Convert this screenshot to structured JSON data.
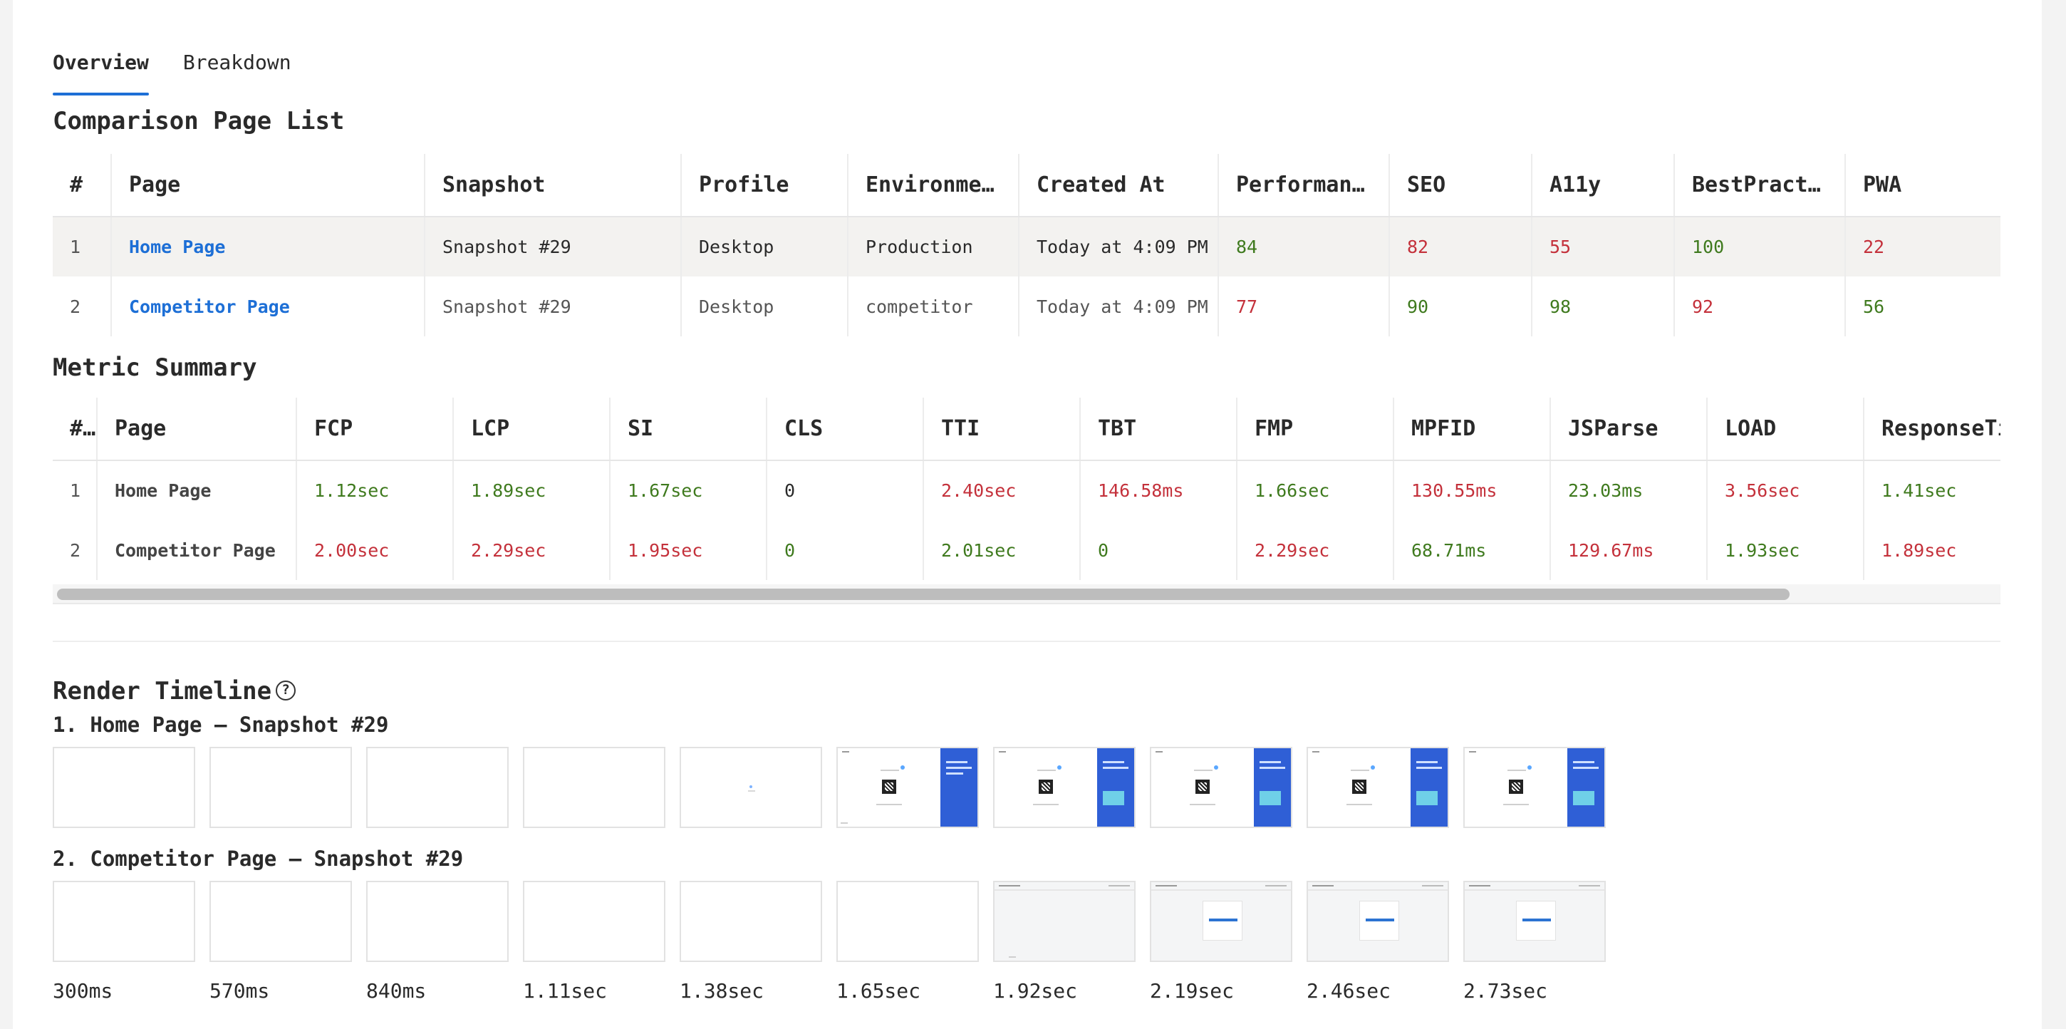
{
  "tabs": [
    {
      "label": "Overview",
      "active": true
    },
    {
      "label": "Breakdown",
      "active": false
    }
  ],
  "comparison": {
    "title": "Comparison Page List",
    "headers": [
      "#",
      "Page",
      "Snapshot",
      "Profile",
      "Environment",
      "Created At",
      "Performance",
      "SEO",
      "A11y",
      "BestPracti…",
      "PWA"
    ],
    "rows": [
      {
        "idx": "1",
        "page": "Home Page",
        "snapshot": "Snapshot #29",
        "profile": "Desktop",
        "environment": "Production",
        "created": "Today at 4:09 PM",
        "performance": "84",
        "seo": "82",
        "a11y": "55",
        "best": "100",
        "pwa": "22"
      },
      {
        "idx": "2",
        "page": "Competitor Page",
        "snapshot": "Snapshot #29",
        "profile": "Desktop",
        "environment": "competitor",
        "created": "Today at 4:09 PM",
        "performance": "77",
        "seo": "90",
        "a11y": "98",
        "best": "92",
        "pwa": "56"
      }
    ]
  },
  "metrics": {
    "title": "Metric Summary",
    "headers": [
      "#",
      "Page",
      "FCP",
      "LCP",
      "SI",
      "CLS",
      "TTI",
      "TBT",
      "FMP",
      "MPFID",
      "JSParse",
      "LOAD",
      "ResponseTi"
    ],
    "rows": [
      {
        "idx": "1",
        "page": "Home Page",
        "values": [
          "1.12sec",
          "1.89sec",
          "1.67sec",
          "0",
          "2.40sec",
          "146.58ms",
          "1.66sec",
          "130.55ms",
          "23.03ms",
          "3.56sec",
          "1.41sec"
        ]
      },
      {
        "idx": "2",
        "page": "Competitor Page",
        "values": [
          "2.00sec",
          "2.29sec",
          "1.95sec",
          "0",
          "2.01sec",
          "0",
          "2.29sec",
          "68.71ms",
          "129.67ms",
          "1.93sec",
          "1.89sec"
        ]
      }
    ]
  },
  "timeline": {
    "title": "Render Timeline",
    "help_icon": "question-circle-icon",
    "home_title": "1. Home Page – Snapshot #29",
    "competitor_title": "2. Competitor Page – Snapshot #29",
    "time_labels": [
      "300ms",
      "570ms",
      "840ms",
      "1.11sec",
      "1.38sec",
      "1.65sec",
      "1.92sec",
      "2.19sec",
      "2.46sec",
      "2.73sec"
    ]
  },
  "colors": {
    "accent": "#1d6fd6",
    "good": "#3f7a1e",
    "bad": "#c4313b"
  }
}
